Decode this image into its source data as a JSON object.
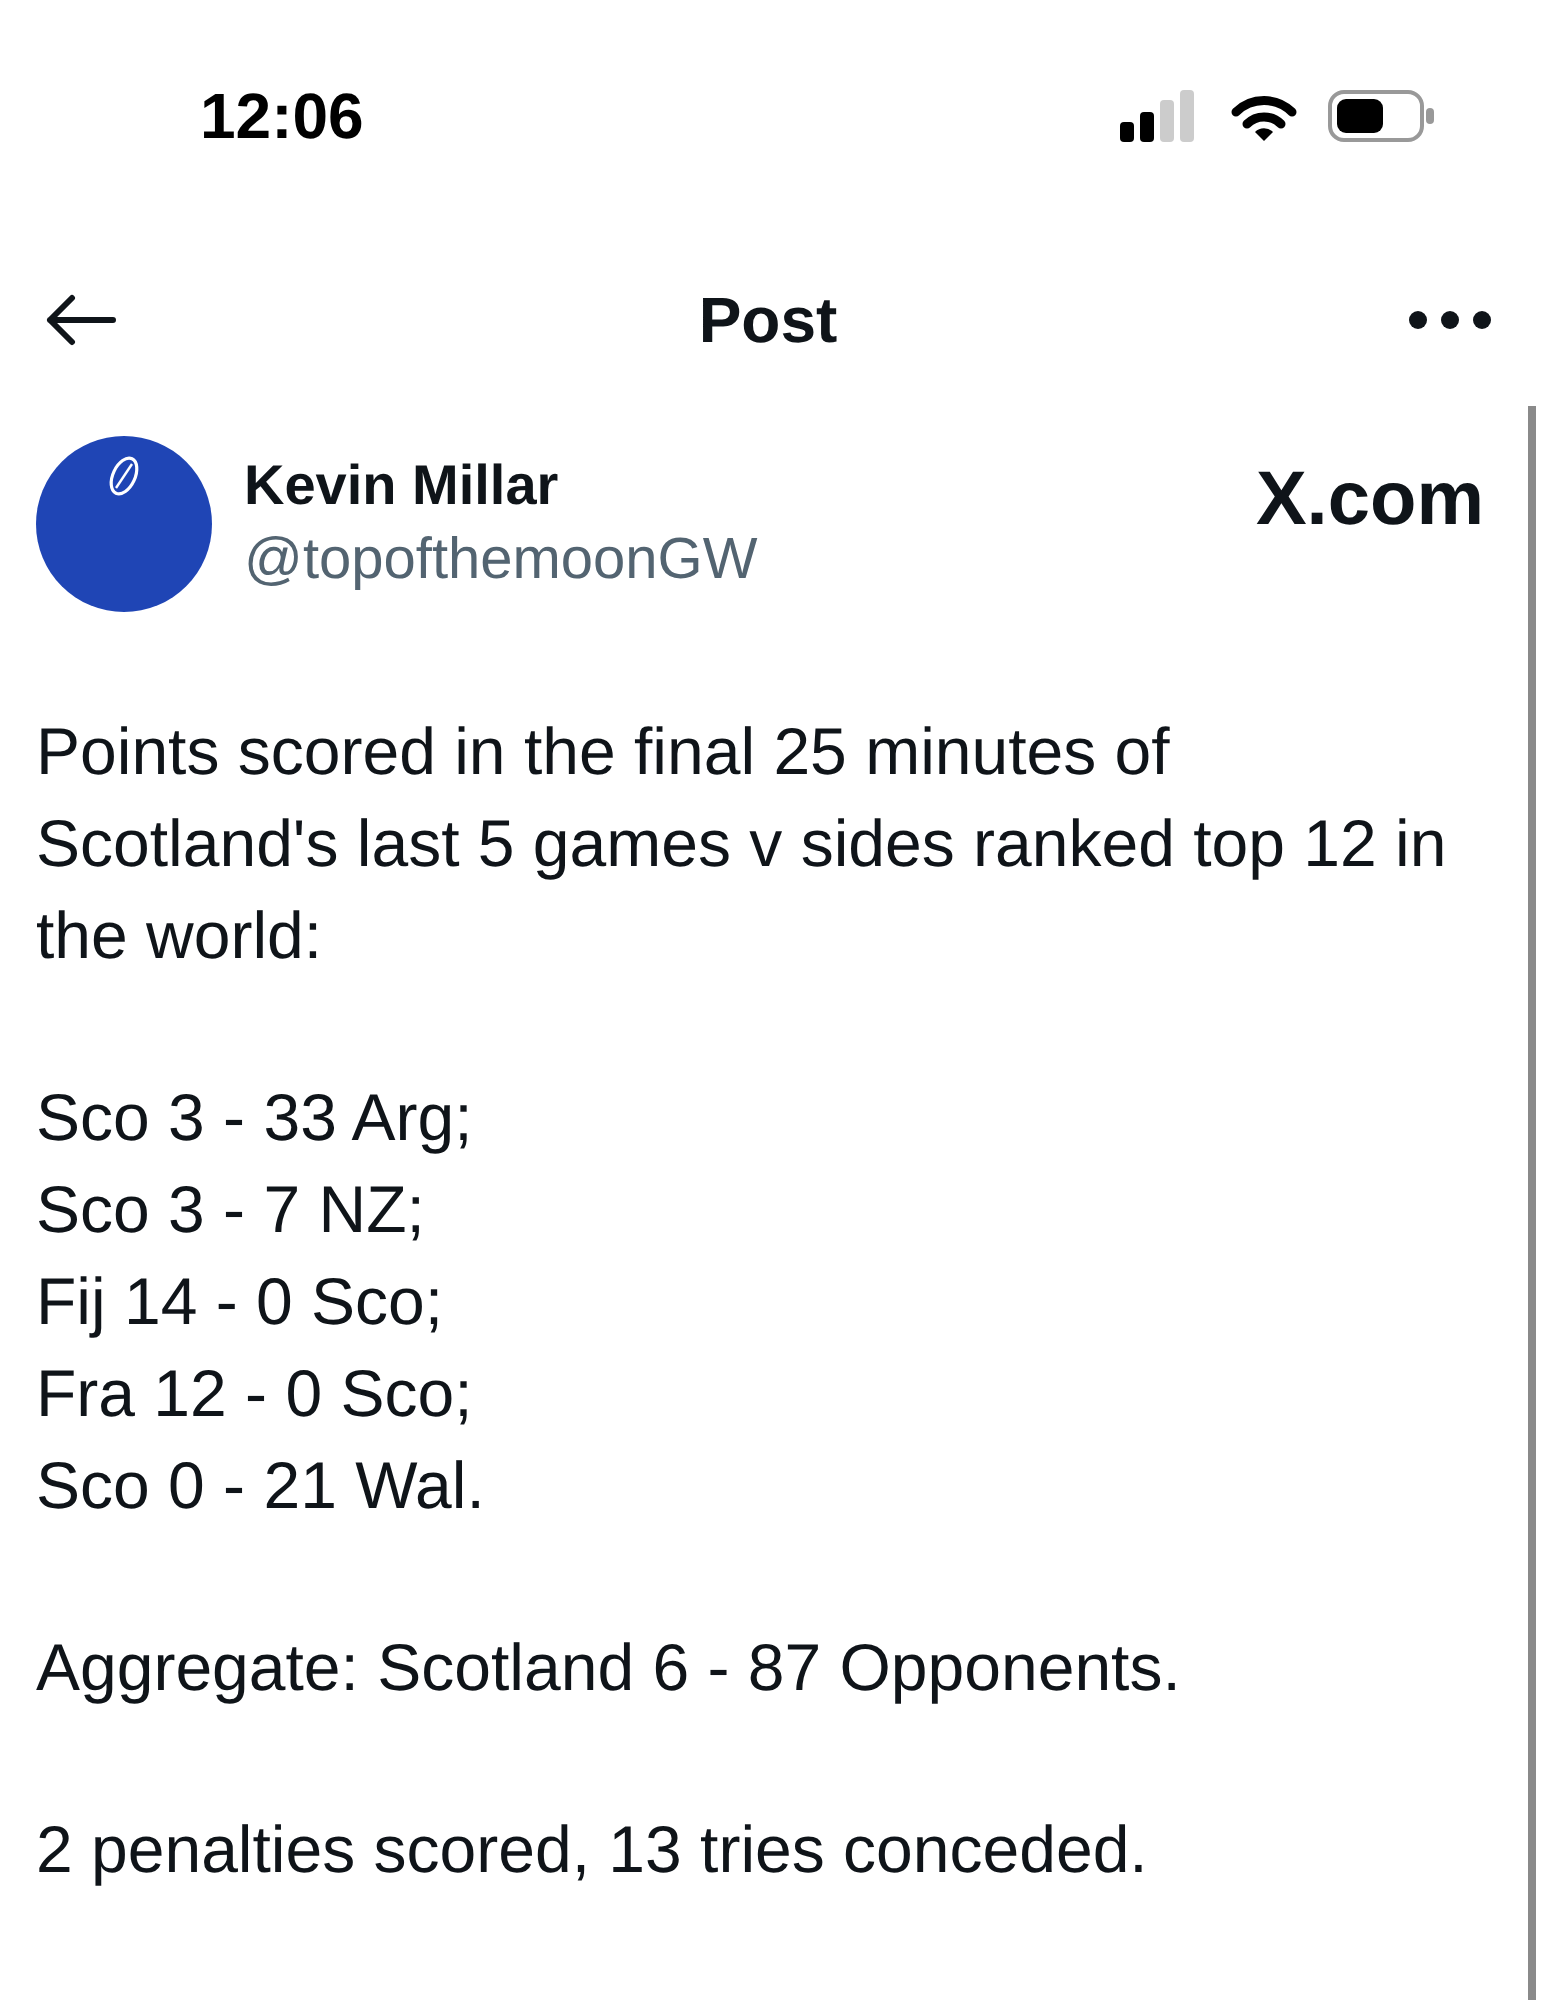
{
  "status_bar": {
    "time": "12:06"
  },
  "nav": {
    "title": "Post"
  },
  "post": {
    "author": {
      "name": "Kevin Millar",
      "handle": "@topofthemoonGW"
    },
    "source": "X.com",
    "paragraphs": [
      "Points scored in the final 25 minutes of Scotland's last 5 games v sides ranked top 12 in the world:",
      "Sco 3 - 33 Arg;\nSco 3 - 7 NZ;\nFij 14 - 0 Sco;\nFra 12 - 0 Sco;\nSco 0 - 21 Wal.",
      "Aggregate: Scotland 6 - 87 Opponents.",
      "2 penalties scored, 13 tries conceded."
    ]
  }
}
